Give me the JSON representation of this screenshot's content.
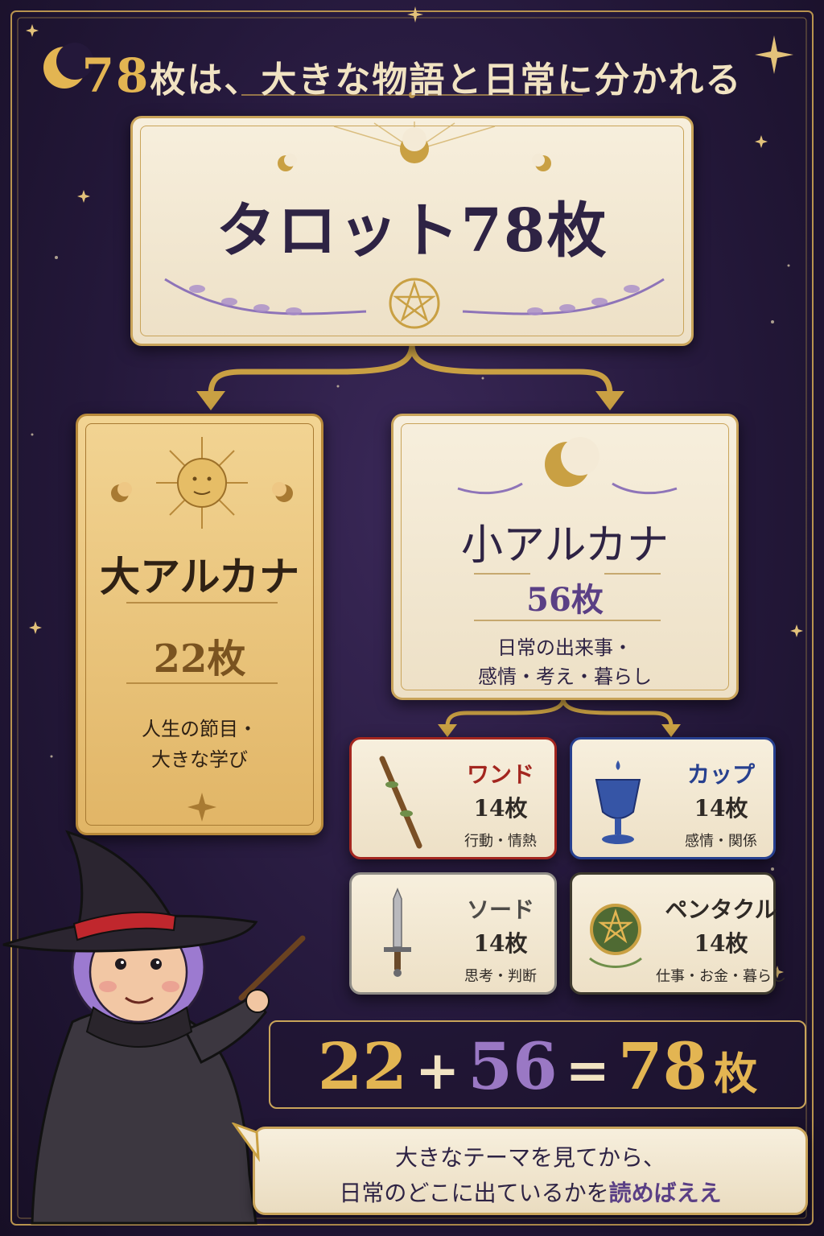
{
  "title": {
    "num": "78",
    "text": "枚は、大きな物語と日常に分かれる"
  },
  "main_card": {
    "title": "タロット78枚"
  },
  "major": {
    "title": "大アルカナ",
    "count": "22枚",
    "desc_line1": "人生の節目・",
    "desc_line2": "大きな学び"
  },
  "minor": {
    "title": "小アルカナ",
    "count": "56枚",
    "desc_line1": "日常の出来事・",
    "desc_line2": "感情・考え・暮らし"
  },
  "suits": [
    {
      "name": "ワンド",
      "count": "14枚",
      "desc": "行動・情熱",
      "color": "#a3261f"
    },
    {
      "name": "カップ",
      "count": "14枚",
      "desc": "感情・関係",
      "color": "#27408f"
    },
    {
      "name": "ソード",
      "count": "14枚",
      "desc": "思考・判断",
      "color": "#4d4b48"
    },
    {
      "name": "ペンタクル",
      "count": "14枚",
      "desc": "仕事・お金・暮らし",
      "color": "#2f2a26"
    }
  ],
  "equation": {
    "n1": "22",
    "op1": "+",
    "n2": "56",
    "op2": "=",
    "n3": "78",
    "unit": "枚"
  },
  "speech": {
    "line1": "大きなテーマを見てから、",
    "line2_a": "日常のどこに出ているかを",
    "line2_b": "読めばええ"
  },
  "colors": {
    "background": "#24183a",
    "gold": "#c9a45a",
    "cream": "#f4ead6",
    "purple": "#5a3f85"
  }
}
